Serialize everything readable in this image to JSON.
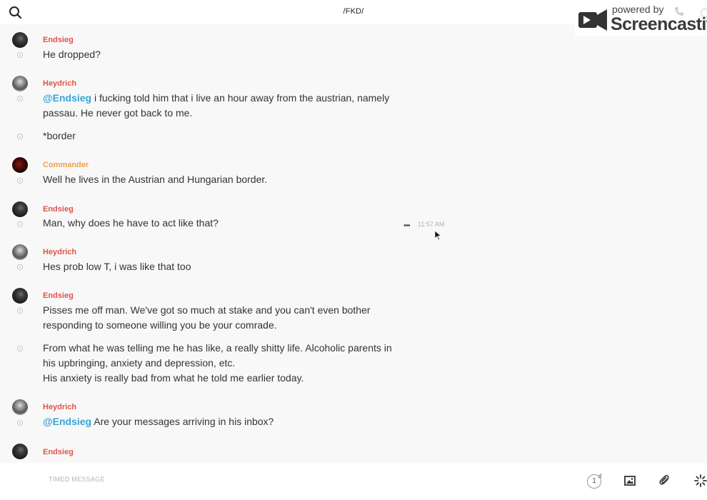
{
  "header": {
    "channel_title": "/FKD/"
  },
  "watermark": {
    "powered_by": "powered by",
    "brand": "Screencastify"
  },
  "messages": [
    {
      "author": "Endsieg",
      "text": "He dropped?"
    },
    {
      "author": "Heydrich",
      "mention": "@Endsieg",
      "text": " i fucking told him that i live an hour away from the austrian, namely passau. He never got back to me."
    },
    {
      "text": "*border"
    },
    {
      "author": "Commander",
      "text": "Well he lives in the Austrian and Hungarian border."
    },
    {
      "author": "Endsieg",
      "text": "Man, why does he have to act like that?",
      "time": "11:57 AM"
    },
    {
      "author": "Heydrich",
      "text": "Hes prob low T, i was like that too"
    },
    {
      "author": "Endsieg",
      "text": "Pisses me off man. We've got so much at stake and you can't even bother responding to someone willing you be your comrade."
    },
    {
      "line1": "From what he was telling me he has like, a really shitty life. Alcoholic parents in his upbringing, anxiety and depression, etc.",
      "line2": "His anxiety is really bad from what he told me earlier today."
    },
    {
      "author": "Heydrich",
      "mention": "@Endsieg",
      "text": " Are your messages arriving in his inbox?"
    },
    {
      "author": "Endsieg"
    }
  ],
  "composer": {
    "placeholder": "TIMED MESSAGE",
    "timer_value": "1",
    "timer_unit": "d"
  },
  "colors": {
    "author_red": "#e0544a",
    "author_orange": "#efa14a",
    "mention_blue": "#3aa3d6",
    "background": "#f8f8f8"
  },
  "icons": [
    "search-icon",
    "phone-icon",
    "info-icon",
    "more-icon",
    "cursor-icon",
    "timer-icon",
    "image-icon",
    "paperclip-icon",
    "loading-icon"
  ]
}
